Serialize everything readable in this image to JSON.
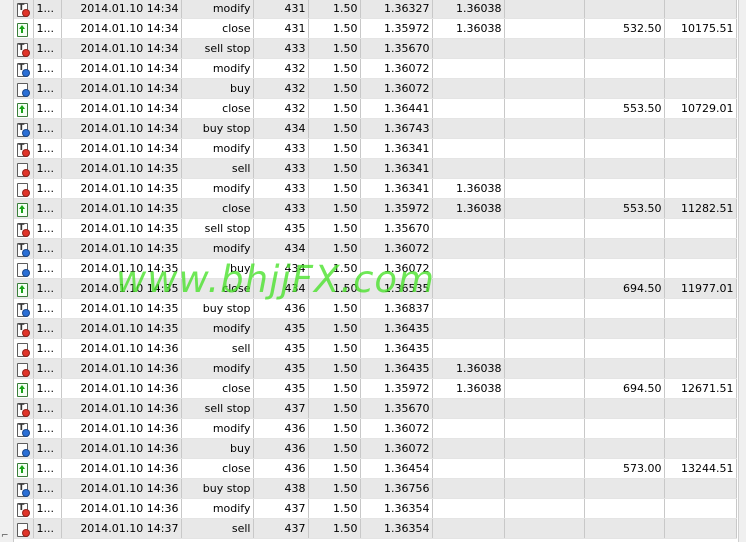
{
  "rows": [
    {
      "no": "1...",
      "time": "2014.01.10 14:34",
      "type": "modify",
      "order": "431",
      "size": "1.50",
      "price": "1.36327",
      "sl": "1.36038",
      "tp": "",
      "profit": "",
      "balance": "",
      "icon": "order-red"
    },
    {
      "no": "1...",
      "time": "2014.01.10 14:34",
      "type": "close",
      "order": "431",
      "size": "1.50",
      "price": "1.35972",
      "sl": "1.36038",
      "tp": "",
      "profit": "532.50",
      "balance": "10175.51",
      "icon": "closed"
    },
    {
      "no": "1...",
      "time": "2014.01.10 14:34",
      "type": "sell stop",
      "order": "433",
      "size": "1.50",
      "price": "1.35670",
      "sl": "",
      "tp": "",
      "profit": "",
      "balance": "",
      "icon": "order-red"
    },
    {
      "no": "1...",
      "time": "2014.01.10 14:34",
      "type": "modify",
      "order": "432",
      "size": "1.50",
      "price": "1.36072",
      "sl": "",
      "tp": "",
      "profit": "",
      "balance": "",
      "icon": "order-blue"
    },
    {
      "no": "1...",
      "time": "2014.01.10 14:34",
      "type": "buy",
      "order": "432",
      "size": "1.50",
      "price": "1.36072",
      "sl": "",
      "tp": "",
      "profit": "",
      "balance": "",
      "icon": "doc-blue"
    },
    {
      "no": "1...",
      "time": "2014.01.10 14:34",
      "type": "close",
      "order": "432",
      "size": "1.50",
      "price": "1.36441",
      "sl": "",
      "tp": "",
      "profit": "553.50",
      "balance": "10729.01",
      "icon": "closed"
    },
    {
      "no": "1...",
      "time": "2014.01.10 14:34",
      "type": "buy stop",
      "order": "434",
      "size": "1.50",
      "price": "1.36743",
      "sl": "",
      "tp": "",
      "profit": "",
      "balance": "",
      "icon": "order-blue"
    },
    {
      "no": "1...",
      "time": "2014.01.10 14:34",
      "type": "modify",
      "order": "433",
      "size": "1.50",
      "price": "1.36341",
      "sl": "",
      "tp": "",
      "profit": "",
      "balance": "",
      "icon": "order-red"
    },
    {
      "no": "1...",
      "time": "2014.01.10 14:35",
      "type": "sell",
      "order": "433",
      "size": "1.50",
      "price": "1.36341",
      "sl": "",
      "tp": "",
      "profit": "",
      "balance": "",
      "icon": "doc-red"
    },
    {
      "no": "1...",
      "time": "2014.01.10 14:35",
      "type": "modify",
      "order": "433",
      "size": "1.50",
      "price": "1.36341",
      "sl": "1.36038",
      "tp": "",
      "profit": "",
      "balance": "",
      "icon": "doc-red"
    },
    {
      "no": "1...",
      "time": "2014.01.10 14:35",
      "type": "close",
      "order": "433",
      "size": "1.50",
      "price": "1.35972",
      "sl": "1.36038",
      "tp": "",
      "profit": "553.50",
      "balance": "11282.51",
      "icon": "closed"
    },
    {
      "no": "1...",
      "time": "2014.01.10 14:35",
      "type": "sell stop",
      "order": "435",
      "size": "1.50",
      "price": "1.35670",
      "sl": "",
      "tp": "",
      "profit": "",
      "balance": "",
      "icon": "order-red"
    },
    {
      "no": "1...",
      "time": "2014.01.10 14:35",
      "type": "modify",
      "order": "434",
      "size": "1.50",
      "price": "1.36072",
      "sl": "",
      "tp": "",
      "profit": "",
      "balance": "",
      "icon": "order-blue"
    },
    {
      "no": "1...",
      "time": "2014.01.10 14:35",
      "type": "buy",
      "order": "434",
      "size": "1.50",
      "price": "1.36072",
      "sl": "",
      "tp": "",
      "profit": "",
      "balance": "",
      "icon": "doc-blue"
    },
    {
      "no": "1...",
      "time": "2014.01.10 14:35",
      "type": "close",
      "order": "434",
      "size": "1.50",
      "price": "1.36535",
      "sl": "",
      "tp": "",
      "profit": "694.50",
      "balance": "11977.01",
      "icon": "closed"
    },
    {
      "no": "1...",
      "time": "2014.01.10 14:35",
      "type": "buy stop",
      "order": "436",
      "size": "1.50",
      "price": "1.36837",
      "sl": "",
      "tp": "",
      "profit": "",
      "balance": "",
      "icon": "order-blue"
    },
    {
      "no": "1...",
      "time": "2014.01.10 14:35",
      "type": "modify",
      "order": "435",
      "size": "1.50",
      "price": "1.36435",
      "sl": "",
      "tp": "",
      "profit": "",
      "balance": "",
      "icon": "order-red"
    },
    {
      "no": "1...",
      "time": "2014.01.10 14:36",
      "type": "sell",
      "order": "435",
      "size": "1.50",
      "price": "1.36435",
      "sl": "",
      "tp": "",
      "profit": "",
      "balance": "",
      "icon": "doc-red"
    },
    {
      "no": "1...",
      "time": "2014.01.10 14:36",
      "type": "modify",
      "order": "435",
      "size": "1.50",
      "price": "1.36435",
      "sl": "1.36038",
      "tp": "",
      "profit": "",
      "balance": "",
      "icon": "doc-red"
    },
    {
      "no": "1...",
      "time": "2014.01.10 14:36",
      "type": "close",
      "order": "435",
      "size": "1.50",
      "price": "1.35972",
      "sl": "1.36038",
      "tp": "",
      "profit": "694.50",
      "balance": "12671.51",
      "icon": "closed"
    },
    {
      "no": "1...",
      "time": "2014.01.10 14:36",
      "type": "sell stop",
      "order": "437",
      "size": "1.50",
      "price": "1.35670",
      "sl": "",
      "tp": "",
      "profit": "",
      "balance": "",
      "icon": "order-red"
    },
    {
      "no": "1...",
      "time": "2014.01.10 14:36",
      "type": "modify",
      "order": "436",
      "size": "1.50",
      "price": "1.36072",
      "sl": "",
      "tp": "",
      "profit": "",
      "balance": "",
      "icon": "order-blue"
    },
    {
      "no": "1...",
      "time": "2014.01.10 14:36",
      "type": "buy",
      "order": "436",
      "size": "1.50",
      "price": "1.36072",
      "sl": "",
      "tp": "",
      "profit": "",
      "balance": "",
      "icon": "doc-blue"
    },
    {
      "no": "1...",
      "time": "2014.01.10 14:36",
      "type": "close",
      "order": "436",
      "size": "1.50",
      "price": "1.36454",
      "sl": "",
      "tp": "",
      "profit": "573.00",
      "balance": "13244.51",
      "icon": "closed"
    },
    {
      "no": "1...",
      "time": "2014.01.10 14:36",
      "type": "buy stop",
      "order": "438",
      "size": "1.50",
      "price": "1.36756",
      "sl": "",
      "tp": "",
      "profit": "",
      "balance": "",
      "icon": "order-blue"
    },
    {
      "no": "1...",
      "time": "2014.01.10 14:36",
      "type": "modify",
      "order": "437",
      "size": "1.50",
      "price": "1.36354",
      "sl": "",
      "tp": "",
      "profit": "",
      "balance": "",
      "icon": "order-red"
    },
    {
      "no": "1...",
      "time": "2014.01.10 14:37",
      "type": "sell",
      "order": "437",
      "size": "1.50",
      "price": "1.36354",
      "sl": "",
      "tp": "",
      "profit": "",
      "balance": "",
      "icon": "doc-red"
    }
  ],
  "watermark": "www.bhjjFX.com",
  "colors": {
    "grid": "#c8c8c8",
    "row_alt": "#e8e8e8",
    "watermark": "#46e128",
    "arrow": "#17a317",
    "dot_red": "#e0352a",
    "dot_blue": "#2a6fd6"
  }
}
